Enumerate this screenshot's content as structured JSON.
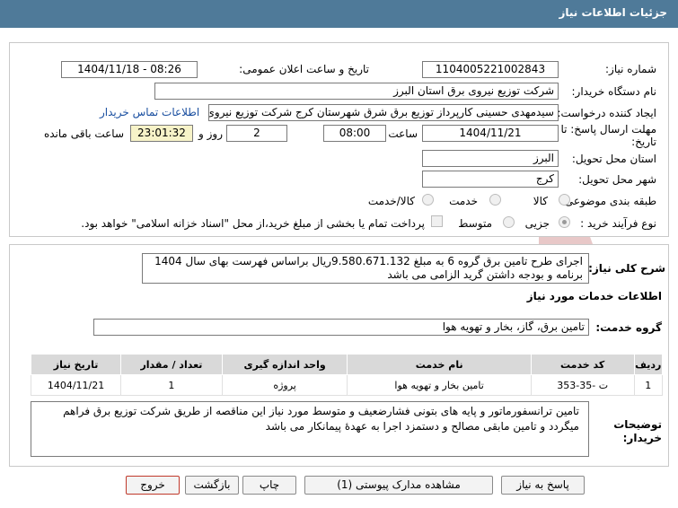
{
  "header": {
    "title": "جزئیات اطلاعات نیاز"
  },
  "need_number": {
    "label": "شماره نیاز:",
    "value": "1104005221002843"
  },
  "announce": {
    "label": "تاریخ و ساعت اعلان عمومی:",
    "value": "1404/11/18 - 08:26"
  },
  "buyer_org": {
    "label": "نام دستگاه خریدار:",
    "value": "شرکت توزیع نیروی برق استان البرز"
  },
  "creator": {
    "label": "ایجاد کننده درخواست:",
    "value": "سیدمهدی حسینی کارپرداز توزیع برق شرق شهرستان کرج شرکت توزیع نیروی",
    "contact_link": "اطلاعات تماس خریدار"
  },
  "deadline": {
    "label_line1": "مهلت ارسال پاسخ: تا",
    "label_line2": "تاریخ:",
    "date": "1404/11/21",
    "time_label": "ساعت",
    "time": "08:00",
    "days": "2",
    "days_label": "روز و",
    "remaining": "23:01:32",
    "remaining_label": "ساعت باقی مانده"
  },
  "province": {
    "label": "استان محل تحویل:",
    "value": "البرز"
  },
  "city": {
    "label": "شهر محل تحویل:",
    "value": "کرج"
  },
  "category": {
    "label": "طبقه بندی موضوعی:",
    "options": [
      "کالا",
      "خدمت",
      "کالا/خدمت"
    ]
  },
  "process": {
    "label": "نوع فرآیند خرید :",
    "options": [
      "جزیی",
      "متوسط"
    ],
    "checkbox_text": "پرداخت تمام یا بخشی از مبلغ خرید،از محل \"اسناد خزانه اسلامی\" خواهد بود."
  },
  "summary": {
    "label": "شرح کلی نیاز:",
    "value": "اجرای طرح تامین برق گروه 6 به مبلغ 9.580.671.132ریال براساس فهرست بهای سال 1404 برنامه و بودجه داشتن گرید الزامی می باشد"
  },
  "services_title": "اطلاعات خدمات مورد نیاز",
  "service_group": {
    "label": "گروه خدمت:",
    "value": "تامین برق، گاز، بخار و تهویه هوا"
  },
  "table": {
    "headers": [
      "ردیف",
      "کد خدمت",
      "نام خدمت",
      "واحد اندازه گیری",
      "تعداد / مقدار",
      "تاریخ نیاز"
    ],
    "rows": [
      [
        "1",
        "ت -35-353",
        "تامین بخار و تهویه هوا",
        "پروژه",
        "1",
        "1404/11/21"
      ]
    ]
  },
  "buyer_notes": {
    "label_line1": "توضیحات",
    "label_line2": "خریدار:",
    "value": "تامین ترانسفورماتور و پایه های بتونی فشارضعیف و متوسط مورد نیاز این مناقصه از طریق شرکت توزیع برق فراهم میگردد و تامین مابقی مصالح و دستمزد اجرا به عهدهٔ پیمانکار می باشد"
  },
  "buttons": {
    "reply": "پاسخ به نیاز",
    "docs": "مشاهده مدارک پیوستی (1)",
    "print": "چاپ",
    "back": "بازگشت",
    "exit": "خروج"
  },
  "watermark": {
    "text": "AriaTender.net"
  },
  "colors": {
    "header": "#4f7a99",
    "link": "#1a4fa0",
    "exit_border": "#c0392b",
    "watermark": "#e8c8c8"
  }
}
